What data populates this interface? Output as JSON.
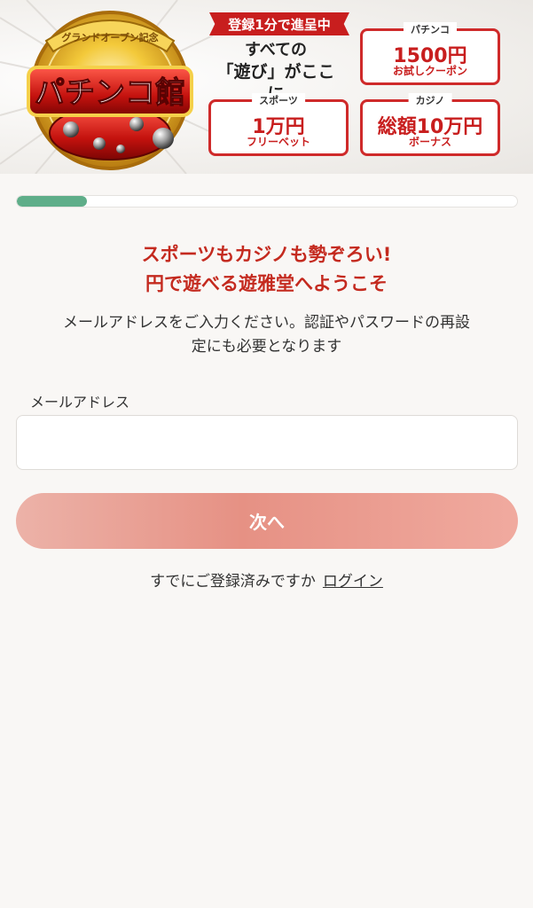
{
  "banner": {
    "logo": {
      "ribbon_text": "グランドオープン記念",
      "title_text": "パチンコ館"
    },
    "tagline": "登録1分で進呈中",
    "promo_line1": "すべての",
    "promo_line2": "「遊び」がここに",
    "cards": [
      {
        "category": "パチンコ",
        "amount": "1500円",
        "sub": "お試しクーポン"
      },
      {
        "category": "スポーツ",
        "amount": "1万円",
        "sub": "フリーベット"
      },
      {
        "category": "カジノ",
        "amount": "総額10万円",
        "sub": "ボーナス"
      }
    ],
    "colors": {
      "accent_red": "#c81e1e",
      "gold": "#e0a820"
    }
  },
  "progress": {
    "value": 0.14,
    "color": "#5fae89"
  },
  "headline": {
    "line1": "スポーツもカジノも勢ぞろい!",
    "line2": "円で遊べる遊雅堂へようこそ"
  },
  "description": {
    "line1": "メールアドレスをご入力ください。認証やパスワードの再設",
    "line2": "定にも必要となります"
  },
  "form": {
    "email_label": "メールアドレス",
    "email_value": "",
    "email_placeholder": ""
  },
  "next_button": {
    "label": "次へ"
  },
  "login": {
    "prompt": "すでにご登録済みですか",
    "link_label": "ログイン"
  }
}
